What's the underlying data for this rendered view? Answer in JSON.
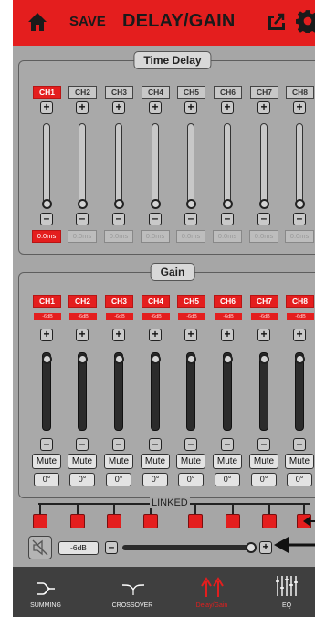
{
  "header": {
    "save_label": "SAVE",
    "title": "DELAY/GAIN",
    "colors": {
      "bar": "#e41e1e"
    }
  },
  "time_delay": {
    "title": "Time Delay",
    "channels": [
      {
        "label": "CH1",
        "active": true,
        "value": "0.0ms"
      },
      {
        "label": "CH2",
        "active": false,
        "value": "0.0ms"
      },
      {
        "label": "CH3",
        "active": false,
        "value": "0.0ms"
      },
      {
        "label": "CH4",
        "active": false,
        "value": "0.0ms"
      },
      {
        "label": "CH5",
        "active": false,
        "value": "0.0ms"
      },
      {
        "label": "CH6",
        "active": false,
        "value": "0.0ms"
      },
      {
        "label": "CH7",
        "active": false,
        "value": "0.0ms"
      },
      {
        "label": "CH8",
        "active": false,
        "value": "0.0ms"
      }
    ]
  },
  "gain": {
    "title": "Gain",
    "channels": [
      {
        "label": "CH1",
        "db": "-6dB",
        "mute": "Mute",
        "phase": "0°"
      },
      {
        "label": "CH2",
        "db": "-6dB",
        "mute": "Mute",
        "phase": "0°"
      },
      {
        "label": "CH3",
        "db": "-6dB",
        "mute": "Mute",
        "phase": "0°"
      },
      {
        "label": "CH4",
        "db": "-6dB",
        "mute": "Mute",
        "phase": "0°"
      },
      {
        "label": "CH5",
        "db": "-6dB",
        "mute": "Mute",
        "phase": "0°"
      },
      {
        "label": "CH6",
        "db": "-6dB",
        "mute": "Mute",
        "phase": "0°"
      },
      {
        "label": "CH7",
        "db": "-6dB",
        "mute": "Mute",
        "phase": "0°"
      },
      {
        "label": "CH8",
        "db": "-6dB",
        "mute": "Mute",
        "phase": "0°"
      }
    ]
  },
  "link": {
    "label": "LINKED"
  },
  "master": {
    "db": "-6dB"
  },
  "nav": {
    "items": [
      {
        "label": "SUMMING",
        "icon": "summing-icon",
        "active": false
      },
      {
        "label": "CROSSOVER",
        "icon": "crossover-icon",
        "active": false
      },
      {
        "label": "Delay/Gain",
        "icon": "delay-gain-icon",
        "active": true
      },
      {
        "label": "EQ",
        "icon": "eq-icon",
        "active": false
      }
    ]
  }
}
